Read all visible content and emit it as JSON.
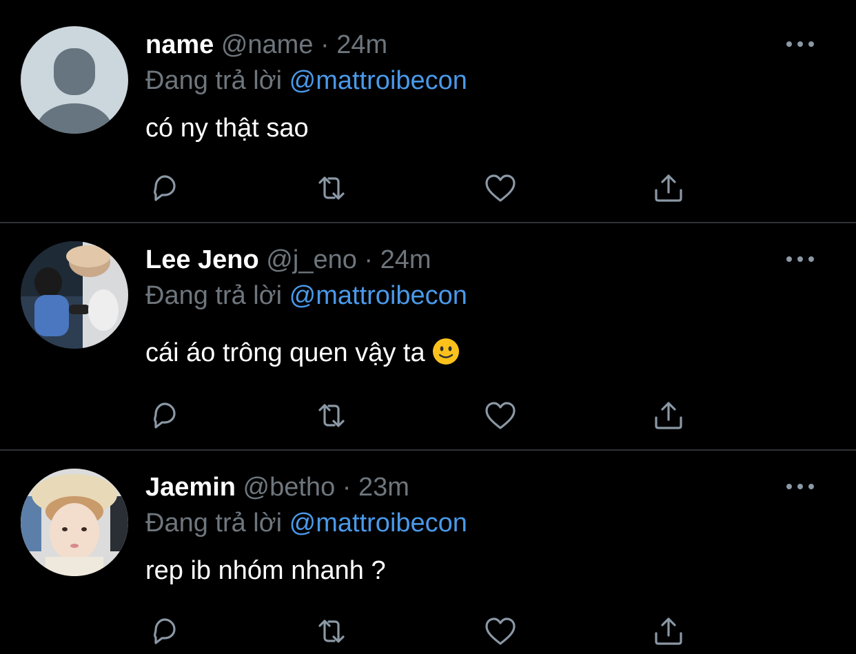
{
  "tweets": [
    {
      "name": "name",
      "handle": "@name",
      "sep": "·",
      "time": "24m",
      "reply_prefix": "Đang trả lời",
      "reply_to": "@mattroibecon",
      "text": "có ny thật sao",
      "avatar": "default-avatar"
    },
    {
      "name": "Lee Jeno",
      "handle": "@j_eno",
      "sep": "·",
      "time": "24m",
      "reply_prefix": "Đang trả lời",
      "reply_to": "@mattroibecon",
      "text": "cái áo trông quen vậy ta",
      "emoji": "slightly-smiling-face",
      "avatar": "photo-avatar"
    },
    {
      "name": "Jaemin",
      "handle": "@betho",
      "sep": "·",
      "time": "23m",
      "reply_prefix": "Đang trả lời",
      "reply_to": "@mattroibecon",
      "text": "rep ib nhóm nhanh ?",
      "avatar": "photo-avatar"
    }
  ],
  "icons": {
    "reply": "comment-icon",
    "retweet": "retweet-icon",
    "like": "heart-icon",
    "share": "share-icon",
    "more": "more-dots-icon"
  },
  "colors": {
    "background": "#000000",
    "muted": "#6e767d",
    "mention": "#4a99e9",
    "divider": "#2f3336"
  }
}
